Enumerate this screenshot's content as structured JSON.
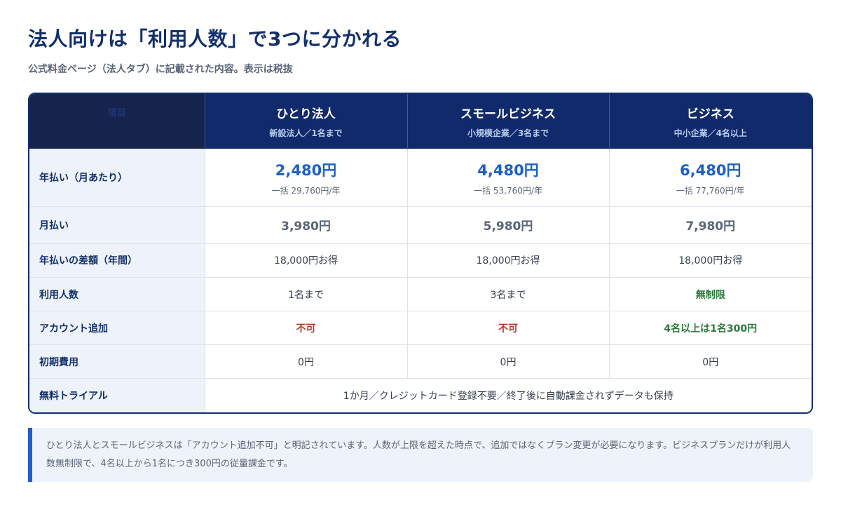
{
  "header": {
    "title": "法人向けは「利用人数」で3つに分かれる",
    "subtitle": "公式料金ページ（法人タブ）に記載された内容。表示は税抜"
  },
  "table": {
    "corner_label": "項目",
    "plans": [
      {
        "name": "ひとり法人",
        "sub": "新設法人／1名まで"
      },
      {
        "name": "スモールビジネス",
        "sub": "小規模企業／3名まで"
      },
      {
        "name": "ビジネス",
        "sub": "中小企業／4名以上"
      }
    ],
    "rows": {
      "annual": {
        "label": "年払い（月あたり）",
        "values": [
          {
            "price": "2,480円",
            "sub": "一括 29,760円/年"
          },
          {
            "price": "4,480円",
            "sub": "一括 53,760円/年"
          },
          {
            "price": "6,480円",
            "sub": "一括 77,760円/年"
          }
        ]
      },
      "monthly": {
        "label": "月払い",
        "values": [
          "3,980円",
          "5,980円",
          "7,980円"
        ]
      },
      "diff": {
        "label": "年払いの差額（年間）",
        "values": [
          "18,000円お得",
          "18,000円お得",
          "18,000円お得"
        ]
      },
      "users": {
        "label": "利用人数",
        "values": [
          "1名まで",
          "3名まで",
          "無制限"
        ]
      },
      "account": {
        "label": "アカウント追加",
        "values": [
          "不可",
          "不可",
          "4名以上は1名300円"
        ]
      },
      "initial": {
        "label": "初期費用",
        "values": [
          "0円",
          "0円",
          "0円"
        ]
      },
      "trial": {
        "label": "無料トライアル",
        "value": "1か月／クレジットカード登録不要／終了後に自動課金されずデータも保持"
      }
    }
  },
  "note": {
    "text": "ひとり法人とスモールビジネスは「アカウント追加不可」と明記されています。人数が上限を超えた時点で、追加ではなくプラン変更が必要になります。ビジネスプランだけが利用人数無制限で、4名以上から1名につき300円の従量課金です。"
  },
  "colors": {
    "title": "#13306b",
    "header_bg": "#102a6b",
    "accent_blue": "#1d5fc5",
    "not_allowed_red": "#b23a22",
    "positive_green": "#2d7a3c",
    "label_bg": "#eef3fb"
  }
}
